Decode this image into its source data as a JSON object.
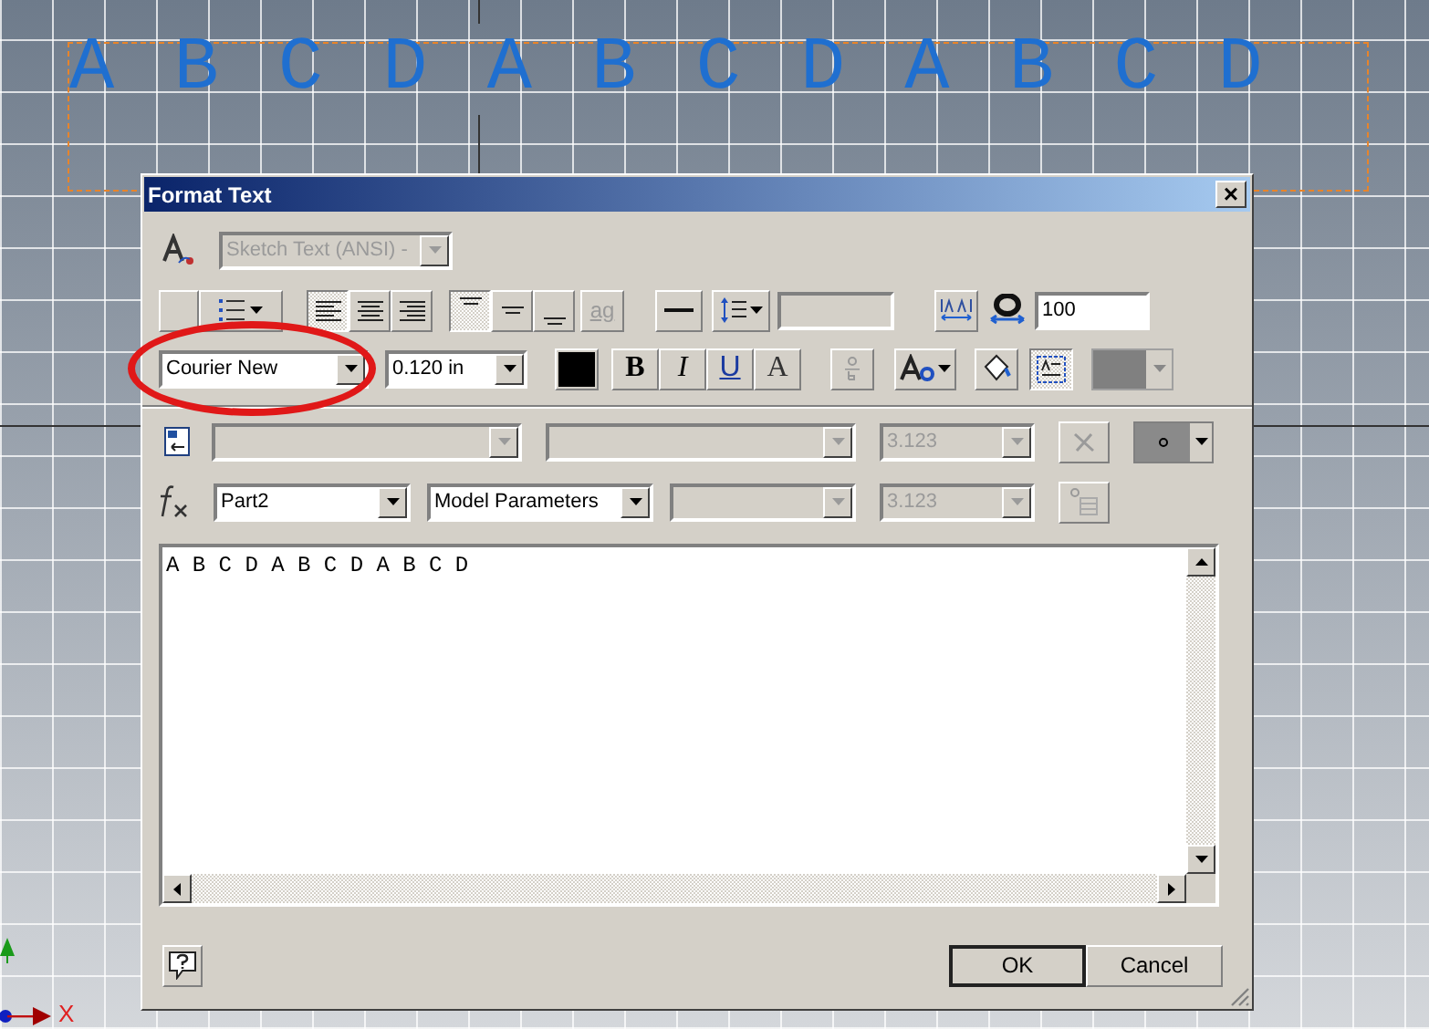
{
  "canvas": {
    "sketch_text": "A B C D A B C D A B C D",
    "axis_label": "X"
  },
  "dialog": {
    "title": "Format Text",
    "close": "×",
    "style": {
      "value": "Sketch Text (ANSI) -",
      "disabled": true
    },
    "justify": [
      {
        "kind": "left",
        "selected": true
      },
      {
        "kind": "center",
        "selected": false
      },
      {
        "kind": "right",
        "selected": false
      }
    ],
    "vertical": [
      {
        "kind": "top",
        "selected": true
      },
      {
        "kind": "middle",
        "selected": false
      },
      {
        "kind": "bottom",
        "selected": false
      }
    ],
    "baseline": {
      "label": "ag",
      "disabled": true
    },
    "stretch": "100",
    "font": "Courier New",
    "size": "0.120 in",
    "color": "#000000",
    "styles": [
      {
        "kind": "bold",
        "label": "B"
      },
      {
        "kind": "italic",
        "label": "I"
      },
      {
        "kind": "underline",
        "label": "U"
      },
      {
        "kind": "strike",
        "label": "A"
      }
    ],
    "frame": {
      "selected": true
    },
    "param_row": [
      {
        "disabled": true
      },
      {
        "disabled": true
      },
      {
        "value": "3.123",
        "disabled": true
      }
    ],
    "params": [
      {
        "value": "Part2",
        "disabled": false
      },
      {
        "value": "Model Parameters",
        "disabled": false
      },
      {
        "disabled": true
      },
      {
        "value": "3.123",
        "disabled": true
      }
    ],
    "text": "A B C D A B C D A B C D",
    "buttons": [
      "OK",
      "Cancel"
    ]
  }
}
